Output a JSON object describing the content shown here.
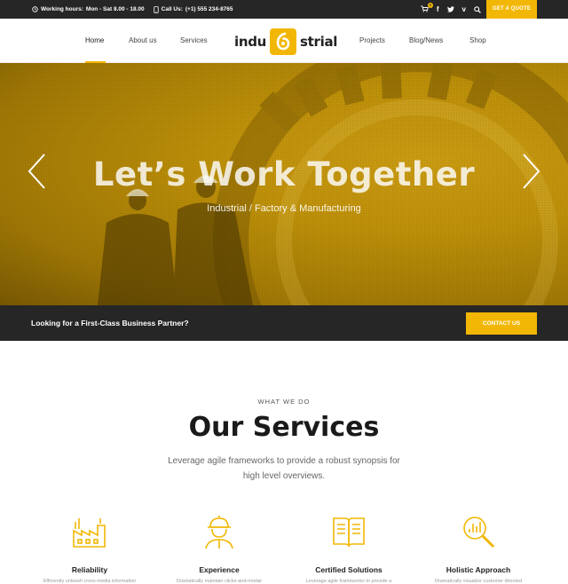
{
  "topbar": {
    "hours_label": "Working hours:",
    "hours_value": "Mon - Sat 8.00 - 18.00",
    "call_label": "Call Us:",
    "call_value": "(+1) 555 234-8765",
    "cart_count": "0",
    "quote_button": "GET A QUOTE",
    "icons": [
      "clock-icon",
      "phone-icon",
      "cart-icon",
      "facebook-icon",
      "twitter-icon",
      "vimeo-icon",
      "search-icon"
    ]
  },
  "nav": {
    "items": [
      "Home",
      "About us",
      "Services",
      "Projects",
      "Blog/News",
      "Shop"
    ],
    "active": "Home",
    "logo_left": "indu",
    "logo_right": "strial"
  },
  "hero": {
    "title": "Let’s Work Together",
    "subtitle": "Industrial / Factory & Manufacturing"
  },
  "cta": {
    "text": "Looking for a First-Class Business Partner?",
    "button": "CONTACT US"
  },
  "services": {
    "eyebrow": "WHAT WE DO",
    "title": "Our Services",
    "description": "Leverage agile frameworks to provide a robust synopsis for high level overviews.",
    "items": [
      {
        "name": "Reliability",
        "desc": "Efficiently unleash cross-media information",
        "icon": "factory-icon"
      },
      {
        "name": "Experience",
        "desc": "Dramatically maintain clicks-and-mortar",
        "icon": "engineer-icon"
      },
      {
        "name": "Certified Solutions",
        "desc": "Leverage agile frameworks to provide a",
        "icon": "book-icon"
      },
      {
        "name": "Holistic Approach",
        "desc": "Dramatically visualize customer directed",
        "icon": "analysis-icon"
      }
    ]
  },
  "colors": {
    "accent": "#f2b705",
    "dark": "#262626"
  }
}
